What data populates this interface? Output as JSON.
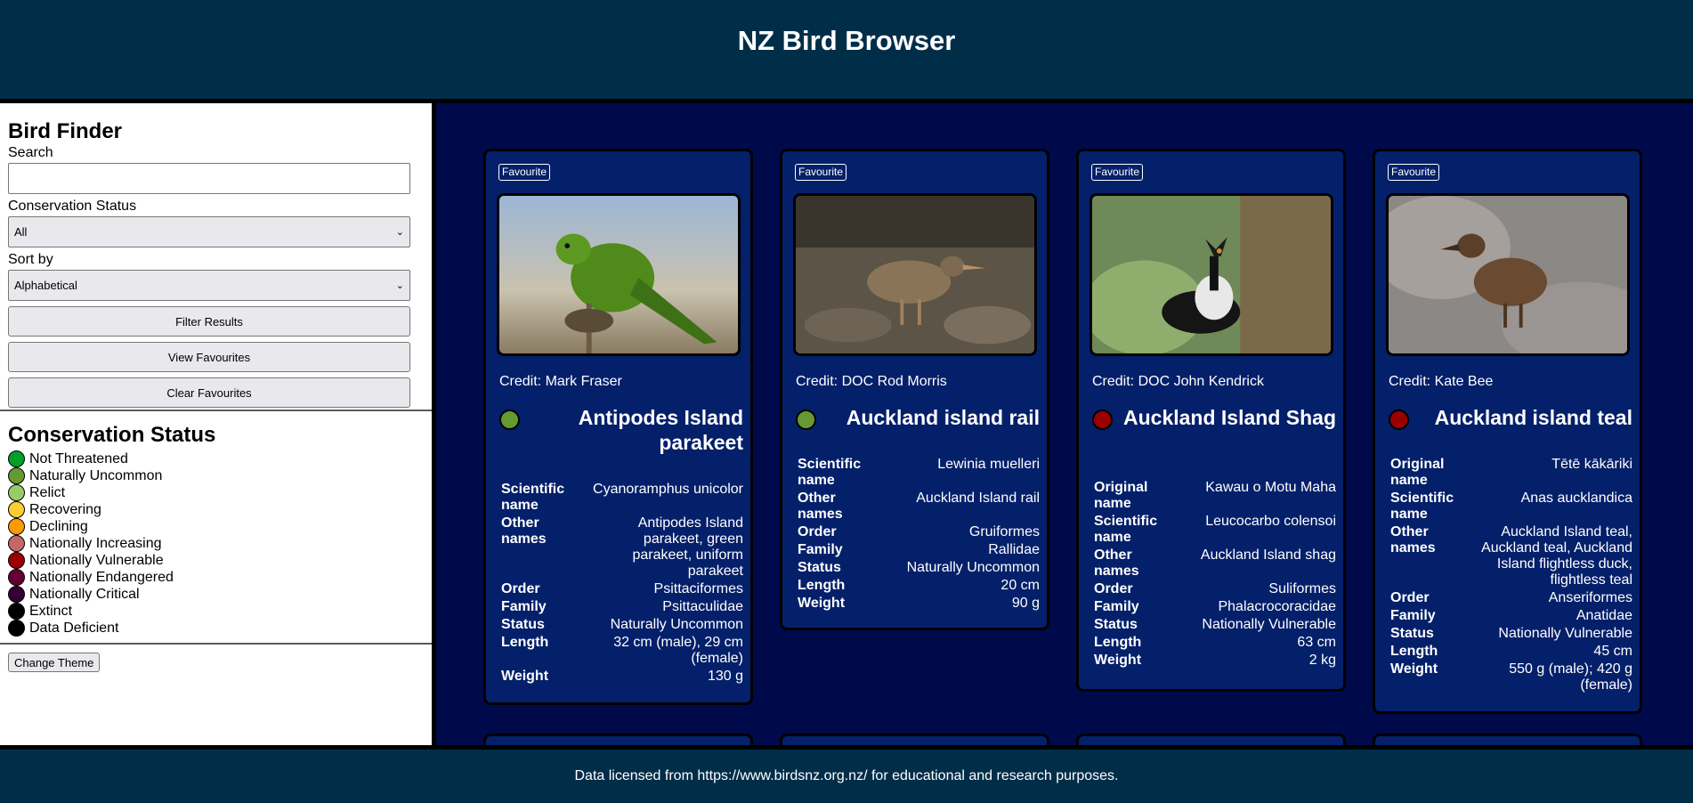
{
  "app": {
    "title": "NZ Bird Browser"
  },
  "sidebar": {
    "title": "Bird Finder",
    "search_label": "Search",
    "search_value": "",
    "conservation_label": "Conservation Status",
    "conservation_value": "All",
    "sort_label": "Sort by",
    "sort_value": "Alphabetical",
    "filter_button": "Filter Results",
    "view_favourites_button": "View Favourites",
    "clear_favourites_button": "Clear Favourites",
    "legend_title": "Conservation Status",
    "legend": [
      {
        "label": "Not Threatened",
        "color": "#02a028"
      },
      {
        "label": "Naturally Uncommon",
        "color": "#649a31"
      },
      {
        "label": "Relict",
        "color": "#99cb68"
      },
      {
        "label": "Recovering",
        "color": "#fecc33"
      },
      {
        "label": "Declining",
        "color": "#fe9a01"
      },
      {
        "label": "Nationally Increasing",
        "color": "#c26967"
      },
      {
        "label": "Nationally Vulnerable",
        "color": "#9b0000"
      },
      {
        "label": "Nationally Endangered",
        "color": "#660032"
      },
      {
        "label": "Nationally Critical",
        "color": "#320033"
      },
      {
        "label": "Extinct",
        "color": "#000000"
      },
      {
        "label": "Data Deficient",
        "color": "#000000"
      }
    ],
    "theme_button": "Change Theme"
  },
  "cards": [
    {
      "favourite": "Favourite",
      "credit": "Credit: Mark Fraser",
      "name": "Antipodes Island parakeet",
      "status_color": "#649a31",
      "facts": [
        {
          "k": "Scientific name",
          "v": "Cyanoramphus unicolor"
        },
        {
          "k": "Other names",
          "v": "Antipodes Island parakeet, green parakeet, uniform parakeet"
        },
        {
          "k": "Order",
          "v": "Psittaciformes"
        },
        {
          "k": "Family",
          "v": "Psittaculidae"
        },
        {
          "k": "Status",
          "v": "Naturally Uncommon"
        },
        {
          "k": "Length",
          "v": "32 cm (male), 29 cm (female)"
        },
        {
          "k": "Weight",
          "v": "130 g"
        }
      ]
    },
    {
      "favourite": "Favourite",
      "credit": "Credit: DOC Rod Morris",
      "name": "Auckland island rail",
      "status_color": "#649a31",
      "facts": [
        {
          "k": "Scientific name",
          "v": "Lewinia muelleri"
        },
        {
          "k": "Other names",
          "v": "Auckland Island rail"
        },
        {
          "k": "Order",
          "v": "Gruiformes"
        },
        {
          "k": "Family",
          "v": "Rallidae"
        },
        {
          "k": "Status",
          "v": "Naturally Uncommon"
        },
        {
          "k": "Length",
          "v": "20 cm"
        },
        {
          "k": "Weight",
          "v": "90 g"
        }
      ]
    },
    {
      "favourite": "Favourite",
      "credit": "Credit: DOC John Kendrick",
      "name": "Auckland Island Shag",
      "status_color": "#9b0000",
      "facts": [
        {
          "k": "Original name",
          "v": "Kawau o Motu Maha"
        },
        {
          "k": "Scientific name",
          "v": "Leucocarbo colensoi"
        },
        {
          "k": "Other names",
          "v": "Auckland Island shag"
        },
        {
          "k": "Order",
          "v": "Suliformes"
        },
        {
          "k": "Family",
          "v": "Phalacrocoracidae"
        },
        {
          "k": "Status",
          "v": "Nationally Vulnerable"
        },
        {
          "k": "Length",
          "v": "63 cm"
        },
        {
          "k": "Weight",
          "v": "2 kg"
        }
      ]
    },
    {
      "favourite": "Favourite",
      "credit": "Credit: Kate Bee",
      "name": "Auckland island teal",
      "status_color": "#9b0000",
      "facts": [
        {
          "k": "Original name",
          "v": "Tētē kākāriki"
        },
        {
          "k": "Scientific name",
          "v": "Anas aucklandica"
        },
        {
          "k": "Other names",
          "v": "Auckland Island teal, Auckland teal, Auckland Island flightless duck, flightless teal"
        },
        {
          "k": "Order",
          "v": "Anseriformes"
        },
        {
          "k": "Family",
          "v": "Anatidae"
        },
        {
          "k": "Status",
          "v": "Nationally Vulnerable"
        },
        {
          "k": "Length",
          "v": "45 cm"
        },
        {
          "k": "Weight",
          "v": "550 g (male); 420 g (female)"
        }
      ]
    }
  ],
  "footer": {
    "text": "Data licensed from https://www.birdsnz.org.nz/ for educational and research purposes."
  }
}
